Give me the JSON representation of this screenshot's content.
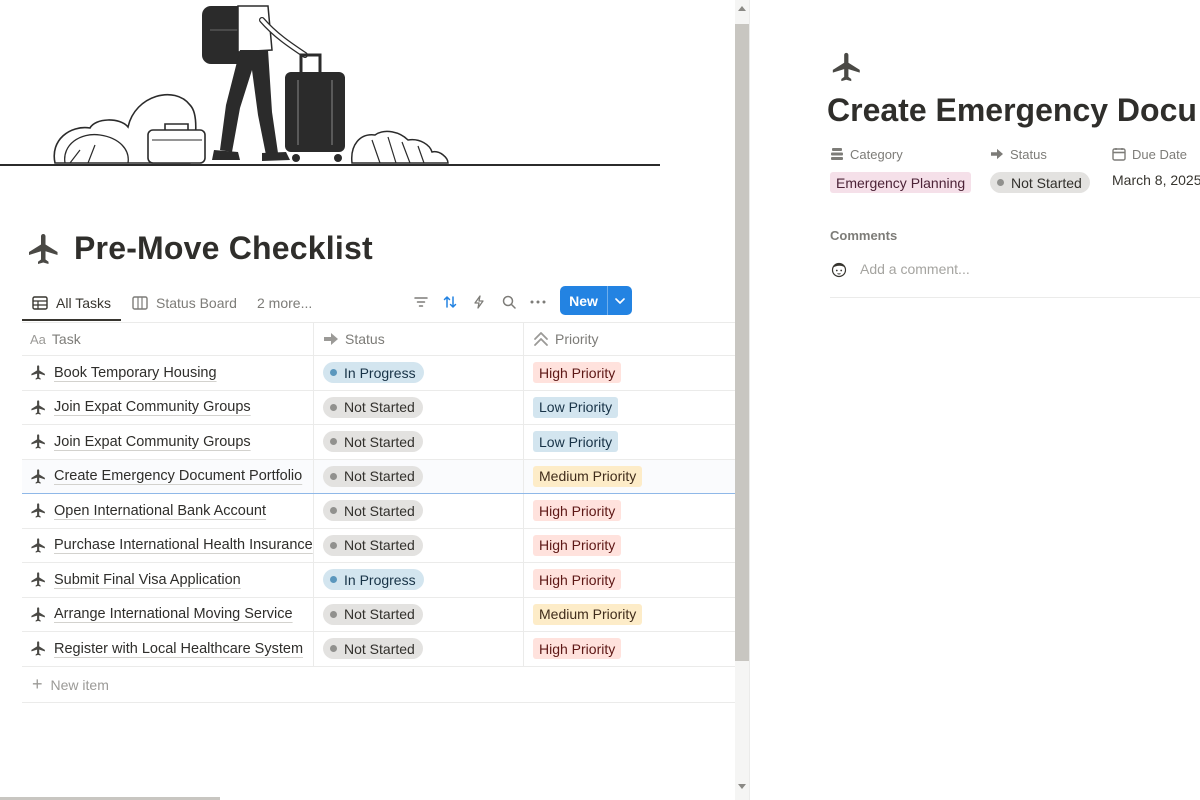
{
  "page": {
    "title": "Pre-Move Checklist",
    "icon": "airplane-icon"
  },
  "views": {
    "tabs": [
      {
        "label": "All Tasks",
        "icon": "table-icon",
        "active": true
      },
      {
        "label": "Status Board",
        "icon": "board-icon",
        "active": false
      }
    ],
    "more_label": "2 more...",
    "toolbar_icons": [
      "filter-icon",
      "sort-icon",
      "automation-icon",
      "search-icon",
      "more-icon"
    ],
    "new_button_label": "New"
  },
  "table": {
    "columns": [
      {
        "label": "Task",
        "icon": "text-icon"
      },
      {
        "label": "Status",
        "icon": "arrow-icon"
      },
      {
        "label": "Priority",
        "icon": "chevrons-up-icon"
      }
    ],
    "rows": [
      {
        "task": "Book Temporary Housing",
        "status": "In Progress",
        "priority": "High Priority"
      },
      {
        "task": "Join Expat Community Groups",
        "status": "Not Started",
        "priority": "Low Priority"
      },
      {
        "task": "Join Expat Community Groups",
        "status": "Not Started",
        "priority": "Low Priority"
      },
      {
        "task": "Create Emergency Document Portfolio",
        "status": "Not Started",
        "priority": "Medium Priority",
        "selected": true
      },
      {
        "task": "Open International Bank Account",
        "status": "Not Started",
        "priority": "High Priority"
      },
      {
        "task": "Purchase International Health Insurance",
        "status": "Not Started",
        "priority": "High Priority"
      },
      {
        "task": "Submit Final Visa Application",
        "status": "In Progress",
        "priority": "High Priority"
      },
      {
        "task": "Arrange International Moving Service",
        "status": "Not Started",
        "priority": "Medium Priority"
      },
      {
        "task": "Register with Local Healthcare System",
        "status": "Not Started",
        "priority": "High Priority"
      }
    ],
    "new_item_label": "New item"
  },
  "status_styles": {
    "In Progress": {
      "bg": "#d3e5ef",
      "dot": "#5b97bd",
      "text": "#183347"
    },
    "Not Started": {
      "bg": "#e3e2e0",
      "dot": "#91918e",
      "text": "#32302c"
    }
  },
  "priority_styles": {
    "High Priority": {
      "bg": "#ffe2dd",
      "text": "#5d1715"
    },
    "Low Priority": {
      "bg": "#d3e5ef",
      "text": "#183347"
    },
    "Medium Priority": {
      "bg": "#fdecc8",
      "text": "#402c1b"
    }
  },
  "detail": {
    "icon": "airplane-icon",
    "title": "Create Emergency Docu",
    "properties": {
      "category_label": "Category",
      "category_value": "Emergency Planning",
      "status_label": "Status",
      "status_value": "Not Started",
      "due_label": "Due Date",
      "due_value": "March 8, 2025"
    },
    "comments_label": "Comments",
    "comment_placeholder": "Add a comment..."
  },
  "colors": {
    "accent": "#2383e2",
    "category_bg": "#f5e0e9",
    "category_text": "#4c2337"
  }
}
